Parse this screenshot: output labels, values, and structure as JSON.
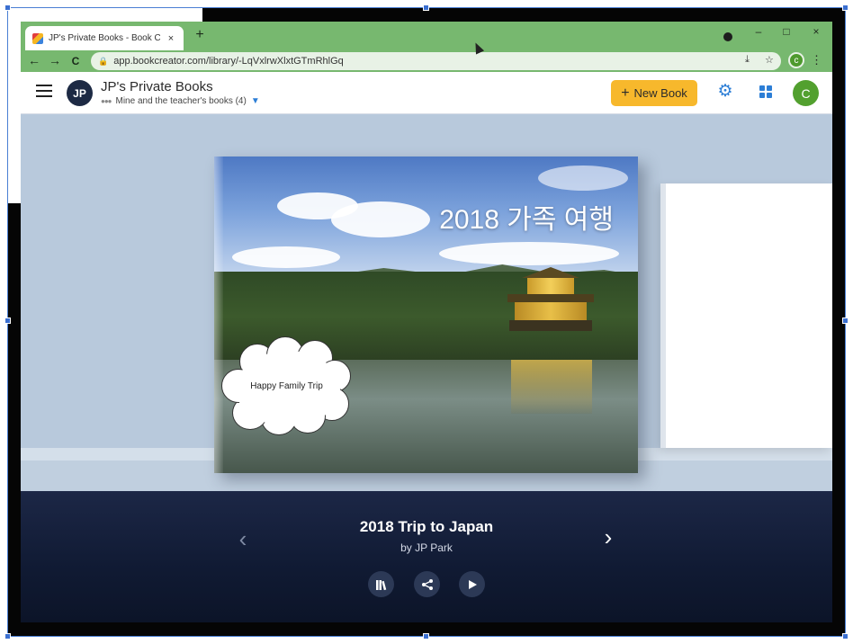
{
  "browser": {
    "tab_title": "JP's Private Books - Book Creat",
    "tab_close": "×",
    "new_tab": "+",
    "minimize": "–",
    "maximize": "□",
    "close": "×",
    "back": "←",
    "forward": "→",
    "reload": "C",
    "url": "app.bookcreator.com/library/-LqVxlrwXlxtGTmRhlGq",
    "profile_initial": "c",
    "menu": "⋮",
    "accent": "#77b86f"
  },
  "header": {
    "library_initials": "JP",
    "library_title": "JP's Private Books",
    "filter_label": "Mine and the teacher's books (4)",
    "new_book_label": "New Book",
    "user_initial": "C",
    "brand_blue": "#2c7ed6",
    "button_yellow": "#f7b82c"
  },
  "book": {
    "cover_title": "2018 가족 여행",
    "bubble_text": "Happy Family Trip",
    "title": "2018 Trip to Japan",
    "author": "by JP Park"
  },
  "controls": {
    "prev": "‹",
    "next": "›",
    "library_icon": "library-icon",
    "share_icon": "share-icon",
    "play_icon": "play-icon"
  }
}
